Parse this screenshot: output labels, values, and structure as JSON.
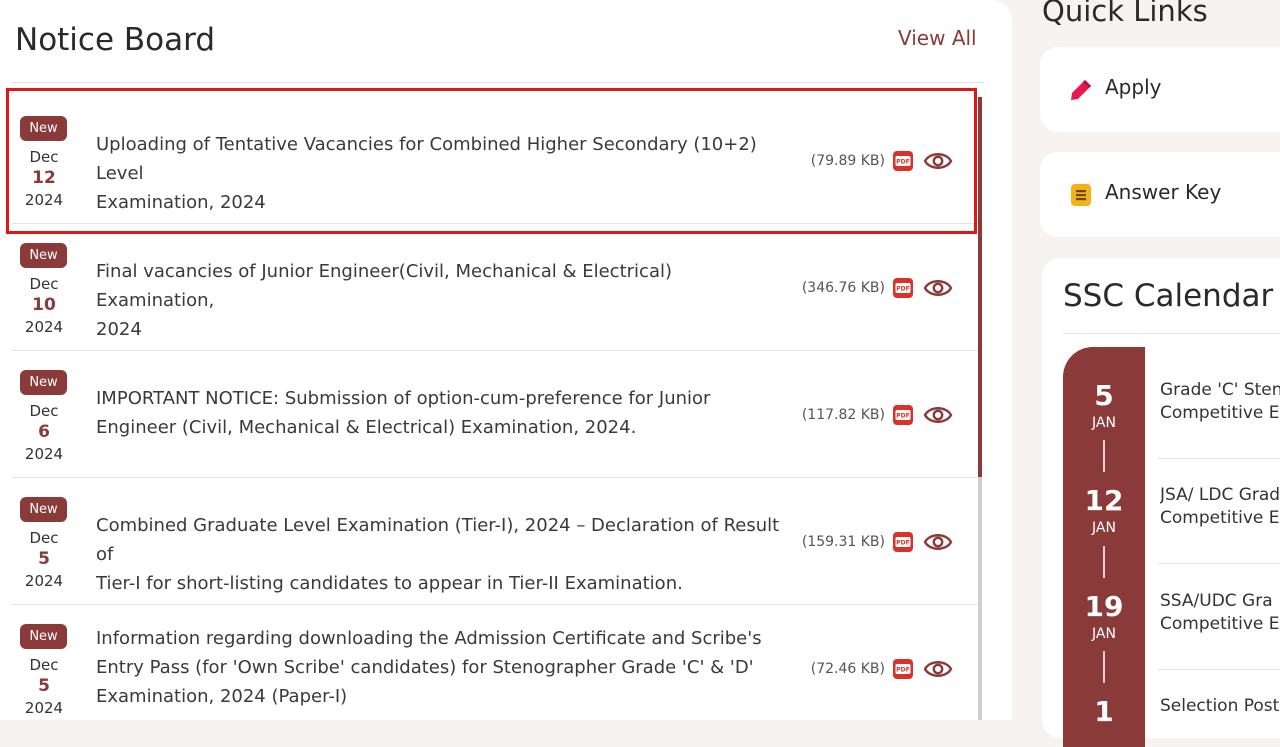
{
  "notice_board": {
    "title": "Notice Board",
    "view_all": "View All",
    "items": [
      {
        "badge": "New",
        "month": "Dec",
        "day": "12",
        "year": "2024",
        "text_line1": "Uploading of Tentative Vacancies for Combined Higher Secondary (10+2) Level",
        "text_line2": "Examination, 2024",
        "text_line3": "",
        "size": "(79.89 KB)",
        "highlighted": true
      },
      {
        "badge": "New",
        "month": "Dec",
        "day": "10",
        "year": "2024",
        "text_line1": "Final vacancies of Junior Engineer(Civil, Mechanical & Electrical) Examination,",
        "text_line2": "2024",
        "text_line3": "",
        "size": "(346.76 KB)"
      },
      {
        "badge": "New",
        "month": "Dec",
        "day": "6",
        "year": "2024",
        "text_line1": "IMPORTANT NOTICE: Submission of option-cum-preference for Junior",
        "text_line2": "Engineer (Civil, Mechanical & Electrical) Examination, 2024.",
        "text_line3": "",
        "size": "(117.82 KB)"
      },
      {
        "badge": "New",
        "month": "Dec",
        "day": "5",
        "year": "2024",
        "text_line1": "Combined Graduate Level Examination (Tier-I), 2024 – Declaration of Result of",
        "text_line2": "Tier-I for short-listing candidates to appear in Tier-II Examination.",
        "text_line3": "",
        "size": "(159.31 KB)"
      },
      {
        "badge": "New",
        "month": "Dec",
        "day": "5",
        "year": "2024",
        "text_line1": "Information regarding downloading the Admission Certificate and Scribe's",
        "text_line2": "Entry Pass (for 'Own Scribe' candidates) for Stenographer Grade 'C' & 'D'",
        "text_line3": "Examination, 2024 (Paper-I)",
        "size": "(72.46 KB)"
      }
    ]
  },
  "quick_links": {
    "title": "Quick Links",
    "items": [
      {
        "label": "Apply",
        "icon": "pencil-icon"
      },
      {
        "label": "Answer Key",
        "icon": "document-icon"
      }
    ]
  },
  "ssc_calendar": {
    "title": "SSC Calendar",
    "events": [
      {
        "day": "5",
        "month": "JAN",
        "line1": "Grade 'C' Sten",
        "line2": "Competitive E"
      },
      {
        "day": "12",
        "month": "JAN",
        "line1": "JSA/ LDC Grad",
        "line2": "Competitive E"
      },
      {
        "day": "19",
        "month": "JAN",
        "line1": "SSA/UDC Gra",
        "line2": "Competitive E"
      },
      {
        "day": "1",
        "month": "",
        "line1": "Selection Post",
        "line2": ""
      }
    ]
  },
  "colors": {
    "brand": "#8b3a3a",
    "highlight": "#e0161b",
    "pdf": "#d9322b",
    "apply_icon": "#e8174d",
    "answer_icon": "#f3b21a"
  }
}
